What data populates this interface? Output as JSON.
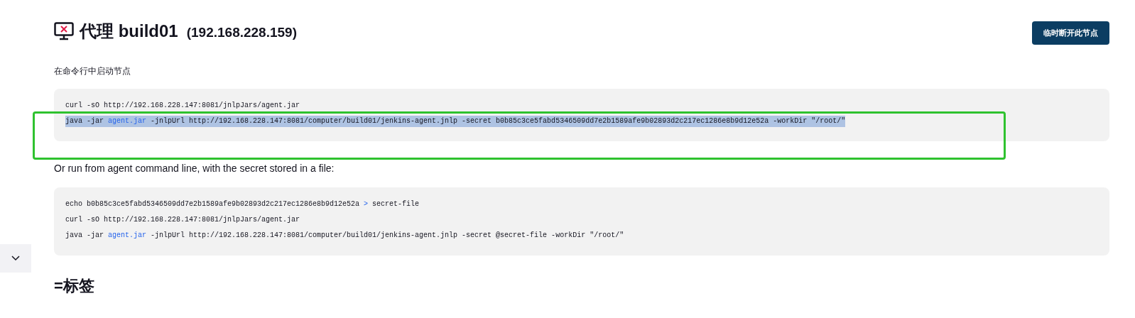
{
  "header": {
    "title": "代理 build01",
    "address": "(192.168.228.159)",
    "button": "临时断开此节点"
  },
  "sections": [
    {
      "intro": "在命令行中启动节点",
      "lines": [
        {
          "selected": false,
          "segments": [
            {
              "kind": "plain",
              "text": "curl -sO http://192.168.228.147:8081/jnlpJars/agent.jar"
            }
          ]
        },
        {
          "selected": true,
          "segments": [
            {
              "kind": "plain",
              "text": "java -jar "
            },
            {
              "kind": "link",
              "text": "agent.jar"
            },
            {
              "kind": "plain",
              "text": " -jnlpUrl http://192.168.228.147:8081/computer/build01/jenkins-agent.jnlp -secret b0b85c3ce5fabd5346509dd7e2b1589afe9b02893d2c217ec1286e8b9d12e52a -workDir \"/root/\""
            }
          ]
        }
      ]
    },
    {
      "intro": "Or run from agent command line, with the secret stored in a file:",
      "lines": [
        {
          "selected": false,
          "segments": [
            {
              "kind": "plain",
              "text": "echo b0b85c3ce5fabd5346509dd7e2b1589afe9b02893d2c217ec1286e8b9d12e52a "
            },
            {
              "kind": "operator",
              "text": ">"
            },
            {
              "kind": "plain",
              "text": " secret-file"
            }
          ]
        },
        {
          "selected": false,
          "segments": [
            {
              "kind": "plain",
              "text": "curl -sO http://192.168.228.147:8081/jnlpJars/agent.jar"
            }
          ]
        },
        {
          "selected": false,
          "segments": [
            {
              "kind": "plain",
              "text": "java -jar "
            },
            {
              "kind": "link",
              "text": "agent.jar"
            },
            {
              "kind": "plain",
              "text": " -jnlpUrl http://192.168.228.147:8081/computer/build01/jenkins-agent.jnlp -secret @secret-file -workDir \"/root/\""
            }
          ]
        }
      ]
    }
  ],
  "labels_heading": "=标签"
}
